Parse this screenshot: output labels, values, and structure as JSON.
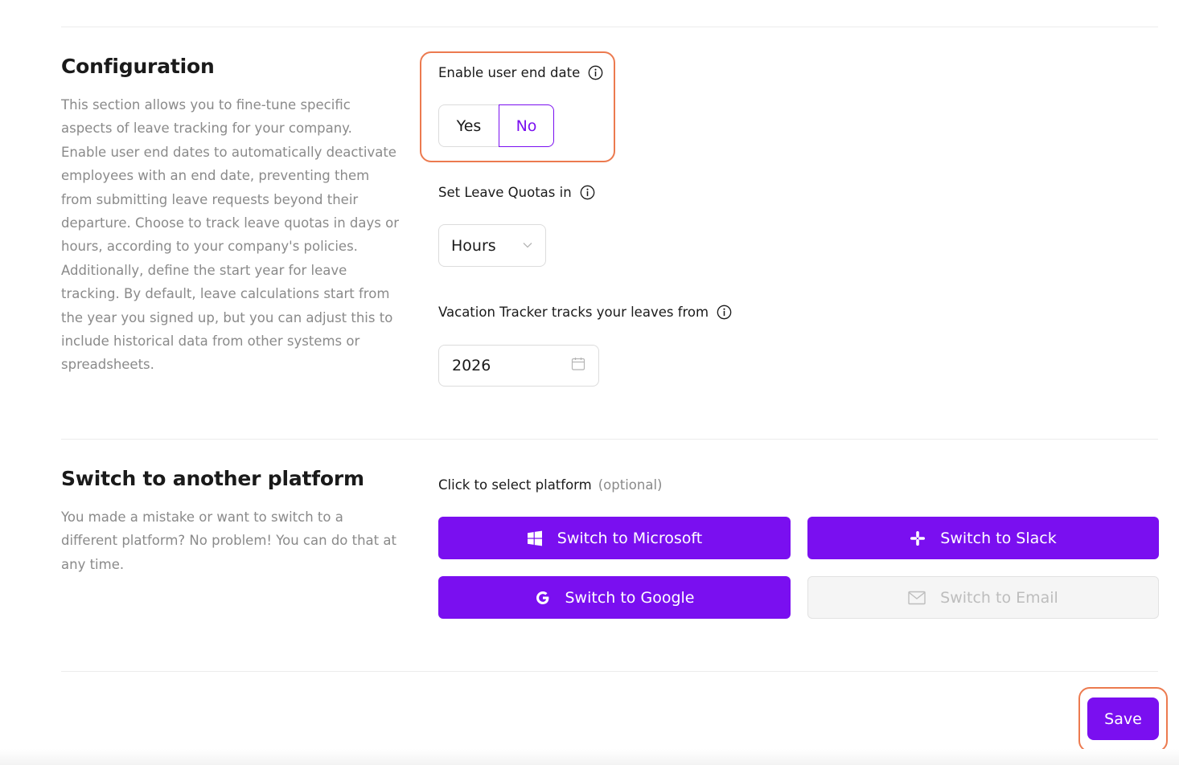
{
  "configuration": {
    "title": "Configuration",
    "description": "This section allows you to fine-tune specific aspects of leave tracking for your company. Enable user end dates to automatically deactivate employees with an end date, preventing them from submitting leave requests beyond their departure. Choose to track leave quotas in days or hours, according to your company's policies. Additionally, define the start year for leave tracking. By default, leave calculations start from the year you signed up, but you can adjust this to include historical data from other systems or spreadsheets.",
    "end_date": {
      "label": "Enable user end date",
      "info_icon": "info-icon",
      "options": [
        "Yes",
        "No"
      ],
      "selected": "No"
    },
    "quotas": {
      "label": "Set Leave Quotas in",
      "info_icon": "info-icon",
      "value": "Hours",
      "icon": "chevron-down-icon"
    },
    "tracking_start": {
      "label": "Vacation Tracker tracks your leaves from",
      "info_icon": "info-icon",
      "value": "2026",
      "icon": "calendar-icon"
    }
  },
  "platform": {
    "title": "Switch to another platform",
    "description": "You made a mistake or want to switch to a different platform? No problem! You can do that at any time.",
    "select_label": "Click to select platform",
    "optional_label": "(optional)",
    "buttons": [
      {
        "label": "Switch to Microsoft",
        "icon": "windows-icon",
        "enabled": true
      },
      {
        "label": "Switch to Slack",
        "icon": "slack-icon",
        "enabled": true
      },
      {
        "label": "Switch to Google",
        "icon": "google-icon",
        "enabled": true
      },
      {
        "label": "Switch to Email",
        "icon": "mail-icon",
        "enabled": false
      }
    ]
  },
  "actions": {
    "save_label": "Save"
  },
  "colors": {
    "accent": "#7a0ff0",
    "highlight": "#ec7a4f",
    "muted_text": "#8a8a8a"
  }
}
